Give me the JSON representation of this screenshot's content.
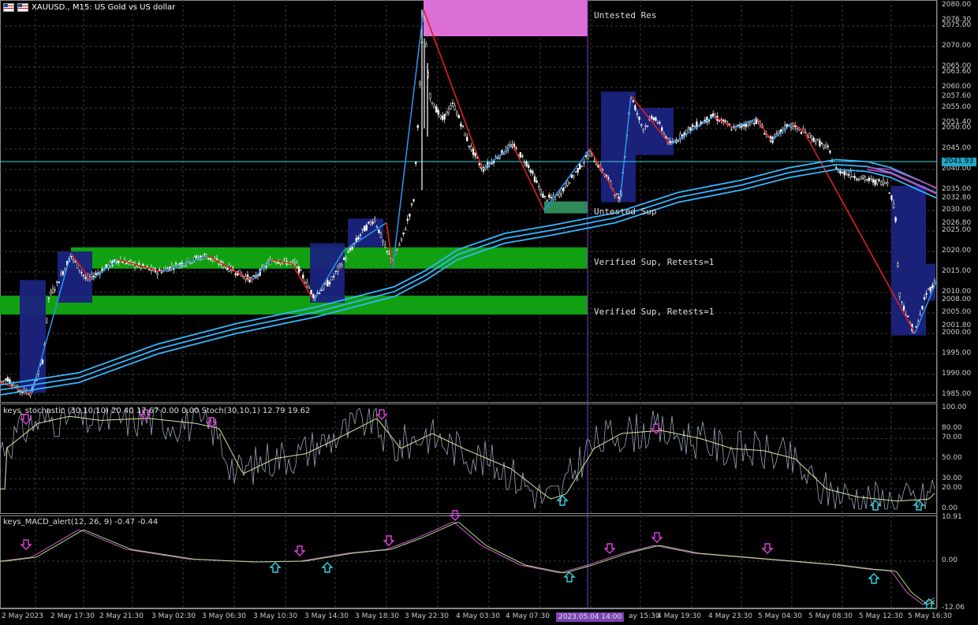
{
  "header": {
    "symbol_line": "XAUUSD., M15:  US Gold vs US dollar"
  },
  "zones": {
    "untested_res": "Untested Res",
    "untested_sup": "Untested Sup",
    "verified_sup_1": "Verified Sup, Retests=1",
    "verified_sup_2": "Verified Sup, Retests=1"
  },
  "price_axis": {
    "labels": [
      "2080.00",
      "2076.30",
      "2075.00",
      "2070.00",
      "2065.00",
      "2063.60",
      "2060.00",
      "2057.60",
      "2055.00",
      "2051.40",
      "2050.00",
      "2045.00",
      "2040.00",
      "2035.00",
      "2032.80",
      "2030.00",
      "2026.80",
      "2025.00",
      "2020.00",
      "2015.00",
      "2010.00",
      "2008.00",
      "2005.00",
      "2001.80",
      "2000.00",
      "1995.00",
      "1990.00",
      "1985.00"
    ],
    "current_price": "2041.93"
  },
  "stoch_pane": {
    "label": "keys_stochastic (30,10,10) 20.40 17.67 0.00 0.00 Stoch(30,10,1) 12.79 19.62",
    "levels": [
      "100.00",
      "80.00",
      "70.00",
      "50.00",
      "30.00",
      "20.00",
      "0.00"
    ]
  },
  "macd_pane": {
    "label": "keys_MACD_alert(12, 26, 9) -0.47 -0.44",
    "levels": [
      "10.91",
      "0.00",
      "-12.06"
    ]
  },
  "time_axis": {
    "labels": [
      "2 May 2023",
      "2 May 17:30",
      "2 May 21:30",
      "3 May 02:30",
      "3 May 06:30",
      "3 May 10:30",
      "3 May 14:30",
      "3 May 18:30",
      "3 May 22:30",
      "4 May 03:30",
      "4 May 07:30",
      "ay 15:30",
      "4 May 19:30",
      "4 May 23:30",
      "5 May 04:30",
      "5 May 08:30",
      "5 May 12:30",
      "5 May 16:30"
    ],
    "crosshair_time": "2023.05.04 14:00"
  },
  "colors": {
    "background": "#000000",
    "grid": "#3a3a3a",
    "resistance_zone": "#dd6fd8",
    "support_zone": "#11a011",
    "untested_sup_zone": "#2e8b57",
    "consolidation_box": "#1a237e",
    "zigzag_up": "#2e8fe6",
    "zigzag_down": "#e02020",
    "moving_avg": "#35b5ff",
    "moving_avg_down": "#c93ab0",
    "candles": "#ffffff",
    "stoch_main": "#9aa3b8",
    "stoch_signal": "#d5e8a0",
    "macd_line": "#d55ad2",
    "macd_signal": "#a8e07c",
    "arrow_down": "#e040e0",
    "arrow_up": "#30d8e8",
    "crosshair": "#7b3fd0"
  }
}
